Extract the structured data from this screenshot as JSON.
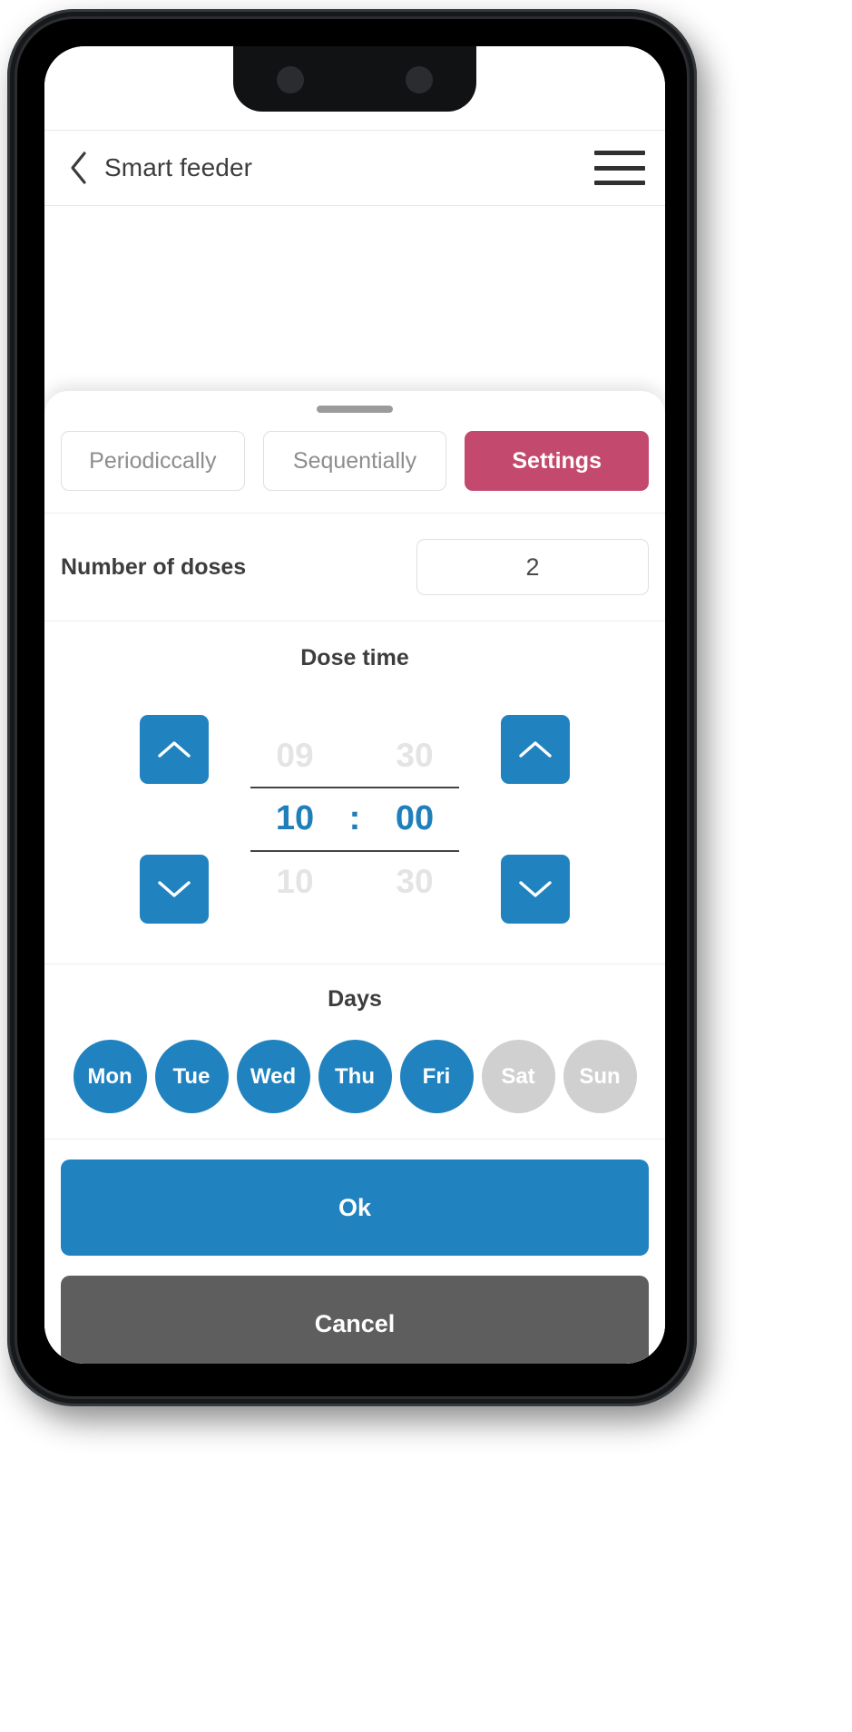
{
  "header": {
    "back_icon": "chevron-left-icon",
    "title": "Smart feeder",
    "menu_icon": "hamburger-menu-icon"
  },
  "sheet": {
    "tabs": [
      {
        "label": "Periodiccally",
        "active": false
      },
      {
        "label": "Sequentially",
        "active": false
      },
      {
        "label": "Settings",
        "active": true
      }
    ],
    "doses": {
      "label": "Number of doses",
      "value": "2"
    },
    "dose_time": {
      "title": "Dose time",
      "hour_prev": "09",
      "minute_prev": "30",
      "hour": "10",
      "colon": ":",
      "minute": "00",
      "hour_next": "10",
      "minute_next": "30",
      "up_icon": "chevron-up-icon",
      "down_icon": "chevron-down-icon"
    },
    "days": {
      "title": "Days",
      "items": [
        {
          "label": "Mon",
          "selected": true
        },
        {
          "label": "Tue",
          "selected": true
        },
        {
          "label": "Wed",
          "selected": true
        },
        {
          "label": "Thu",
          "selected": true
        },
        {
          "label": "Fri",
          "selected": true
        },
        {
          "label": "Sat",
          "selected": false
        },
        {
          "label": "Sun",
          "selected": false
        }
      ]
    },
    "actions": {
      "ok_label": "Ok",
      "cancel_label": "Cancel"
    }
  },
  "colors": {
    "accent_blue": "#2083bf",
    "accent_pink": "#c3496e",
    "inactive_gray": "#d0d0d0",
    "cancel_gray": "#5e5e5e",
    "ghost_text": "#e4e4e4"
  }
}
